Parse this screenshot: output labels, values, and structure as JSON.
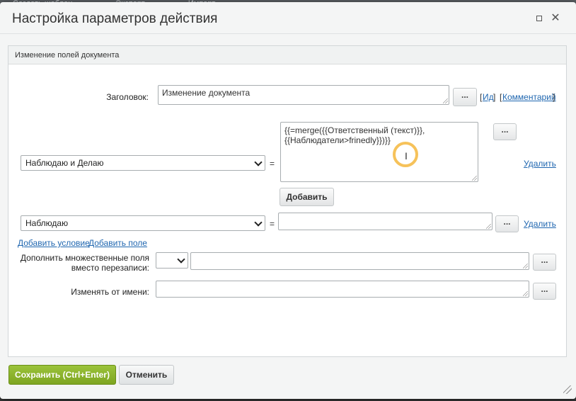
{
  "background": {
    "items": [
      "Создать шаблон",
      "Экспорт",
      "Импорт"
    ]
  },
  "dialog": {
    "title": "Настройка параметров действия",
    "section_title": "Изменение полей документа",
    "heading": {
      "label": "Заголовок:",
      "value": "Изменение документа",
      "id_link": "Ид",
      "comment_link": "Комментарий"
    },
    "rows": [
      {
        "field": "Наблюдаю и Делаю",
        "value_line1": "{{=merge({{Ответственный (текст)}},",
        "value_line2": "{{Наблюдатели>frinedly}})}}",
        "delete": "Удалить"
      },
      {
        "field": "Наблюдаю",
        "value": "",
        "delete": "Удалить"
      }
    ],
    "equals": "=",
    "add_button": "Добавить",
    "add_condition_link": "Добавить условие",
    "add_field_link": "Добавить поле",
    "append_multi": {
      "label_line1": "Дополнить множественные поля",
      "label_line2": "вместо перезаписи:",
      "select_value": ""
    },
    "modify_as": {
      "label": "Изменять от имени:"
    },
    "dots": "...",
    "save_button": "Сохранить (Ctrl+Enter)",
    "cancel_button": "Отменить"
  },
  "colors": {
    "accent_green": "#8bb32e",
    "link_blue": "#2067b0",
    "cursor_ring": "#f6c25a"
  },
  "icons": [
    "maximize-icon",
    "close-icon",
    "chevron-down-icon",
    "text-cursor-icon",
    "resize-grip-icon"
  ]
}
